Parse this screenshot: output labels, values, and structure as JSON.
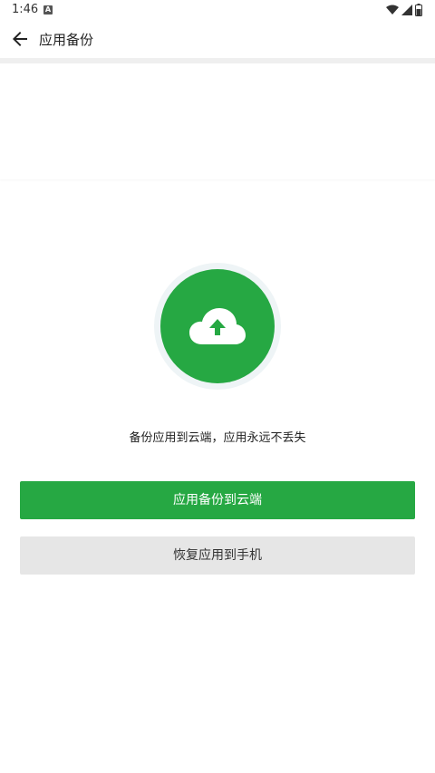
{
  "status_bar": {
    "time": "1:46",
    "notification_letter": "A"
  },
  "app_bar": {
    "title": "应用备份"
  },
  "main": {
    "caption": "备份应用到云端，应用永远不丢失",
    "primary_button_label": "应用备份到云端",
    "secondary_button_label": "恢复应用到手机"
  },
  "colors": {
    "accent": "#26a843",
    "secondary_button_bg": "#e6e6e6"
  },
  "icons": [
    "back-arrow-icon",
    "cloud-upload-icon",
    "wifi-icon",
    "signal-icon",
    "battery-icon"
  ]
}
